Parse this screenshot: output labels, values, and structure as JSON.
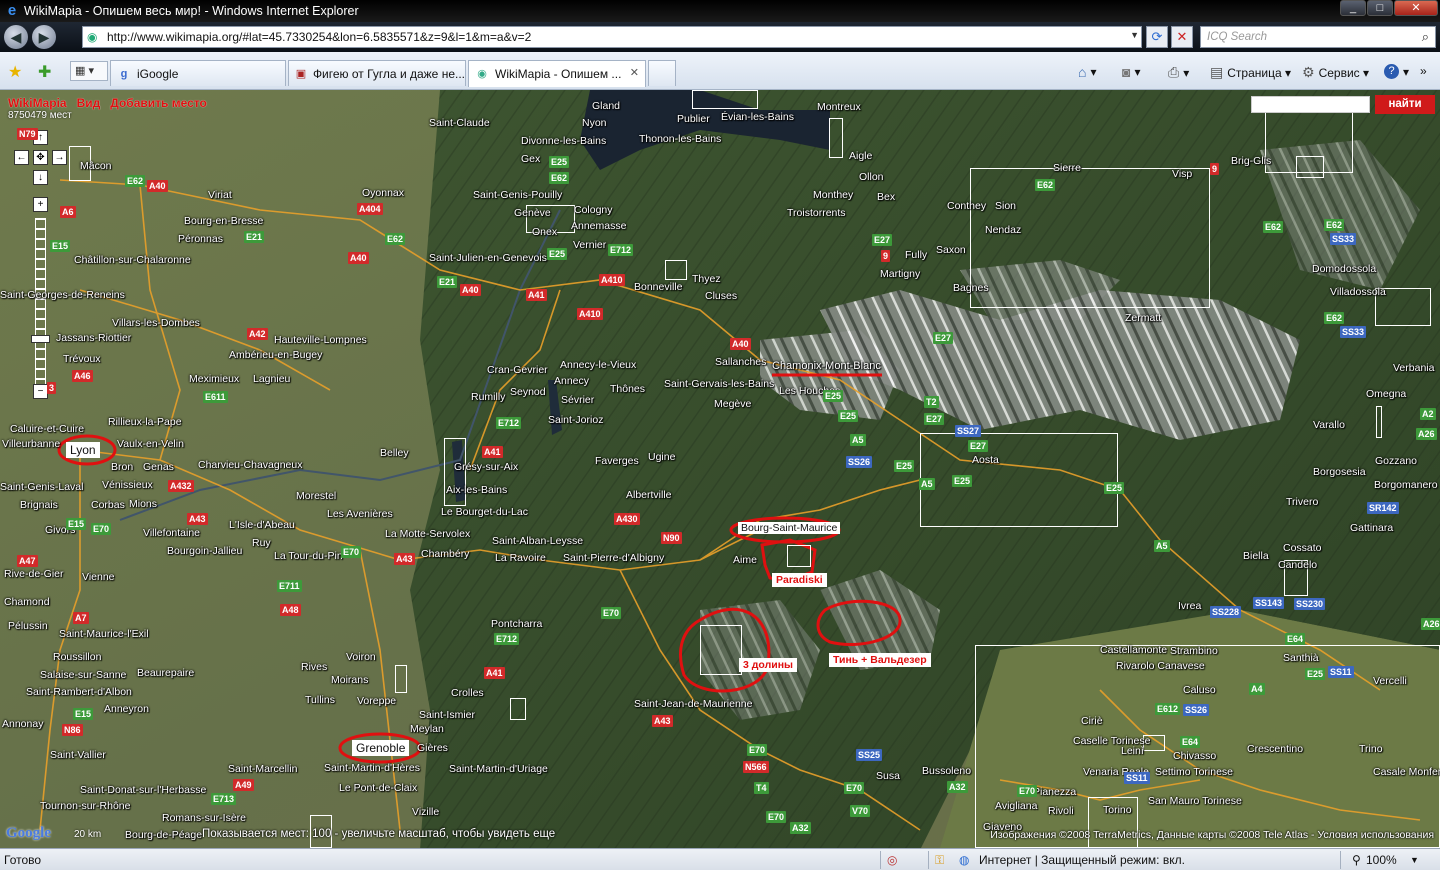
{
  "window": {
    "title": "WikiMapia - Опишем весь мир! - Windows Internet Explorer",
    "buttons": {
      "minimize": "_",
      "maximize": "□",
      "close": "✕"
    }
  },
  "address": {
    "url": "http://www.wikimapia.org/#lat=45.7330254&lon=6.5835571&z=9&l=1&m=a&v=2",
    "search_placeholder": "ICQ Search"
  },
  "tabs": [
    {
      "label": "iGoogle",
      "icon": "google-icon",
      "active": false
    },
    {
      "label": "Фигею от Гугла и даже не...",
      "icon": "page-icon",
      "active": false
    },
    {
      "label": "WikiMapia - Опишем ...",
      "icon": "ie-page-icon",
      "active": true
    }
  ],
  "commandbar": {
    "page": "Страница",
    "tools": "Сервис",
    "help": "?"
  },
  "map": {
    "brand": "WikiMapia",
    "menu_view": "Вид",
    "menu_add": "Добавить место",
    "places_count": "8750479 мест",
    "find_button": "найти",
    "highlighted": {
      "lyon": "Lyon",
      "grenoble": "Grenoble",
      "bsm": "Bourg-Saint-Maurice",
      "paradiski": "Paradiski",
      "three_valleys": "3 долины",
      "tignes": "Тинь + Вальдезер",
      "chamonix": "Chamonix-Mont-Blanc"
    },
    "places": [
      "Mâcon",
      "Viriat",
      "Bourg-en-Bresse",
      "Péronnas",
      "Châtillon-sur-Chalaronne",
      "Saint-Georges-de-Reneins",
      "Villars-les-Dombes",
      "Jassans-Riottier",
      "Trévoux",
      "Ambérieu-en-Bugey",
      "Hauteville-Lompnes",
      "Meximieux",
      "Lagnieu",
      "Rillieux-la-Pape",
      "Caluire-et-Cuire",
      "Vaulx-en-Velin",
      "Bron",
      "Genas",
      "Vénissieux",
      "Charvieu-Chavagneux",
      "Saint-Genis-Laval",
      "Corbas",
      "Mions",
      "Brignais",
      "Villefontaine",
      "Bourgoin-Jallieu",
      "L'Isle-d'Abeau",
      "Givors",
      "Vienne",
      "Rive-de-Gier",
      "Chamond",
      "Pélussin",
      "Saint-Maurice-l'Exil",
      "Roussillon",
      "Salaise-sur-Sanne",
      "Beaurepaire",
      "Saint-Rambert-d'Albon",
      "Anneyron",
      "Annonay",
      "Saint-Vallier",
      "Saint-Donat-sur-l'Herbasse",
      "Tournon-sur-Rhône",
      "Romans-sur-Isère",
      "Bourg-de-Péage",
      "Saint-Marcellin",
      "Rives",
      "Moirans",
      "Voiron",
      "Voreppe",
      "Tullins",
      "Meylan",
      "Saint-Ismier",
      "Crolles",
      "Gières",
      "Saint-Martin-d'Hères",
      "Le Pont-de-Claix",
      "Vizille",
      "Saint-Martin-d'Uriage",
      "Chambéry",
      "La Motte-Servolex",
      "Le Bourget-du-Lac",
      "Saint-Alban-Leysse",
      "La Ravoire",
      "Saint-Pierre-d'Albigny",
      "Pontcharra",
      "Aix-les-Bains",
      "Grésy-sur-Aix",
      "Belley",
      "Morestel",
      "Les Avenières",
      "La Tour-du-Pin",
      "Ruy",
      "Rumilly",
      "Seynod",
      "Annecy",
      "Annecy-le-Vieux",
      "Cran-Gevrier",
      "Sévrier",
      "Saint-Jorioz",
      "Thônes",
      "Faverges",
      "Ugine",
      "Albertville",
      "Saint-Gervais-les-Bains",
      "Megève",
      "Sallanches",
      "Cluses",
      "Bonneville",
      "Thyez",
      "Annemasse",
      "Genève",
      "Cologny",
      "Onex",
      "Vernier",
      "Saint-Julien-en-Genevois",
      "Saint-Genis-Pouilly",
      "Divonne-les-Bains",
      "Gex",
      "Oyonnax",
      "Saint-Claude",
      "Gland",
      "Nyon",
      "Thonon-les-Bains",
      "Publier",
      "Évian-les-Bains",
      "Montreux",
      "Aigle",
      "Ollon",
      "Bex",
      "Monthey",
      "Troistorrents",
      "Martigny",
      "Fully",
      "Saxon",
      "Conthey",
      "Sion",
      "Nendaz",
      "Bagnes",
      "Sierre",
      "Visp",
      "Brig-Glis",
      "Zermatt",
      "Domodossola",
      "Villadossola",
      "Verbania",
      "Omegna",
      "Varallo",
      "Gozzano",
      "Borgomanero",
      "Borgosesia",
      "Trivero",
      "Gattinara",
      "Biella",
      "Cossato",
      "Candelo",
      "Ivrea",
      "Santhià",
      "Castellamonte",
      "Strambino",
      "Rivarolo Canavese",
      "Caluso",
      "Ciriè",
      "Caselle Torinese",
      "Leinì",
      "Chivasso",
      "Crescentino",
      "Trino",
      "Casale Monferrato",
      "Venaria Reale",
      "Settimo Torinese",
      "San Mauro Torinese",
      "Torino",
      "Pianezza",
      "Avigliana",
      "Rivoli",
      "Giaveno",
      "Susa",
      "Bussoleno",
      "Aosta",
      "Les Houches",
      "Aime",
      "Saint-Jean-de-Maurienne",
      "Vercelli",
      "Lyon",
      "Villeurbanne"
    ],
    "scale": "20 km",
    "showing": "Показывается мест: 100 - увеличьте масштаб, чтобы увидеть еще",
    "copyright": "Изображения ©2008 TerraMetrics, Данные карты ©2008 Tele Atlas - Условия использования"
  },
  "status": {
    "left": "Готово",
    "zone": "Интернет | Защищенный режим: вкл.",
    "zoom": "100%"
  },
  "colors": {
    "accent_red": "#e01010",
    "route_green": "#3d9a3a",
    "route_red": "#d22a2a",
    "route_blue": "#3d68c0"
  }
}
